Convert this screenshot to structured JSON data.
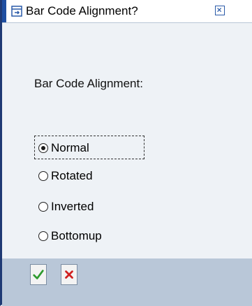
{
  "dialog": {
    "title": "Bar Code Alignment?",
    "title_icon": "window-arrow-icon",
    "close_icon": "close-icon"
  },
  "content": {
    "label": "Bar Code Alignment:",
    "options": [
      {
        "label": "Normal",
        "selected": true
      },
      {
        "label": "Rotated",
        "selected": false
      },
      {
        "label": "Inverted",
        "selected": false
      },
      {
        "label": "Bottomup",
        "selected": false
      }
    ]
  },
  "footer": {
    "ok_icon": "checkmark-icon",
    "cancel_icon": "cancel-x-icon"
  },
  "colors": {
    "title_accent": "#1f4fa1",
    "footer_bg": "#b9c7d8",
    "ok_green": "#2e9b2e",
    "cancel_red": "#d02020"
  }
}
